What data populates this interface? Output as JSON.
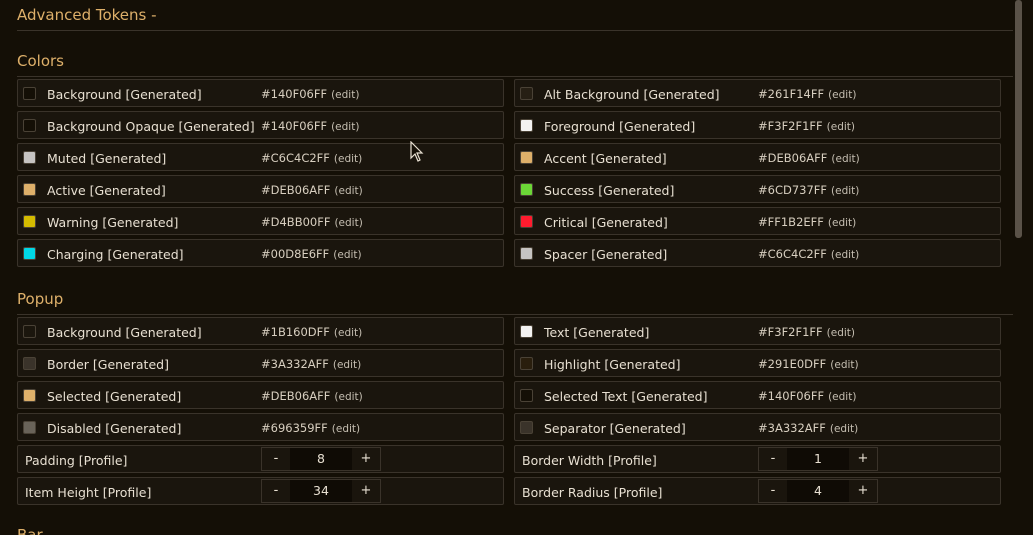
{
  "title": "Advanced Tokens -",
  "sections": {
    "colors": {
      "title": "Colors",
      "left": [
        {
          "label": "Background [Generated]",
          "hex": "#140F06FF",
          "color": "#140F06"
        },
        {
          "label": "Background Opaque [Generated]",
          "hex": "#140F06FF",
          "color": "#140F06"
        },
        {
          "label": "Muted [Generated]",
          "hex": "#C6C4C2FF",
          "color": "#C6C4C2"
        },
        {
          "label": "Active [Generated]",
          "hex": "#DEB06AFF",
          "color": "#DEB06A"
        },
        {
          "label": "Warning [Generated]",
          "hex": "#D4BB00FF",
          "color": "#D4BB00"
        },
        {
          "label": "Charging [Generated]",
          "hex": "#00D8E6FF",
          "color": "#00D8E6"
        }
      ],
      "right": [
        {
          "label": "Alt Background [Generated]",
          "hex": "#261F14FF",
          "color": "#261F14"
        },
        {
          "label": "Foreground [Generated]",
          "hex": "#F3F2F1FF",
          "color": "#F3F2F1"
        },
        {
          "label": "Accent [Generated]",
          "hex": "#DEB06AFF",
          "color": "#DEB06A"
        },
        {
          "label": "Success [Generated]",
          "hex": "#6CD737FF",
          "color": "#6CD737"
        },
        {
          "label": "Critical [Generated]",
          "hex": "#FF1B2EFF",
          "color": "#FF1B2E"
        },
        {
          "label": "Spacer [Generated]",
          "hex": "#C6C4C2FF",
          "color": "#C6C4C2"
        }
      ]
    },
    "popup": {
      "title": "Popup",
      "left": [
        {
          "label": "Background [Generated]",
          "hex": "#1B160DFF",
          "color": "#1B160D"
        },
        {
          "label": "Border [Generated]",
          "hex": "#3A332AFF",
          "color": "#3A332A"
        },
        {
          "label": "Selected [Generated]",
          "hex": "#DEB06AFF",
          "color": "#DEB06A"
        },
        {
          "label": "Disabled [Generated]",
          "hex": "#696359FF",
          "color": "#696359"
        }
      ],
      "right": [
        {
          "label": "Text [Generated]",
          "hex": "#F3F2F1FF",
          "color": "#F3F2F1"
        },
        {
          "label": "Highlight [Generated]",
          "hex": "#291E0DFF",
          "color": "#291E0D"
        },
        {
          "label": "Selected Text [Generated]",
          "hex": "#140F06FF",
          "color": "#140F06"
        },
        {
          "label": "Separator [Generated]",
          "hex": "#3A332AFF",
          "color": "#3A332A"
        }
      ],
      "steppers_left": [
        {
          "label": "Padding [Profile]",
          "value": "8"
        },
        {
          "label": "Item Height [Profile]",
          "value": "34"
        }
      ],
      "steppers_right": [
        {
          "label": "Border Width [Profile]",
          "value": "1"
        },
        {
          "label": "Border Radius [Profile]",
          "value": "4"
        }
      ]
    },
    "next": {
      "title": "Bar"
    }
  },
  "edit_label": "(edit)",
  "minus_label": "-",
  "plus_label": "+"
}
